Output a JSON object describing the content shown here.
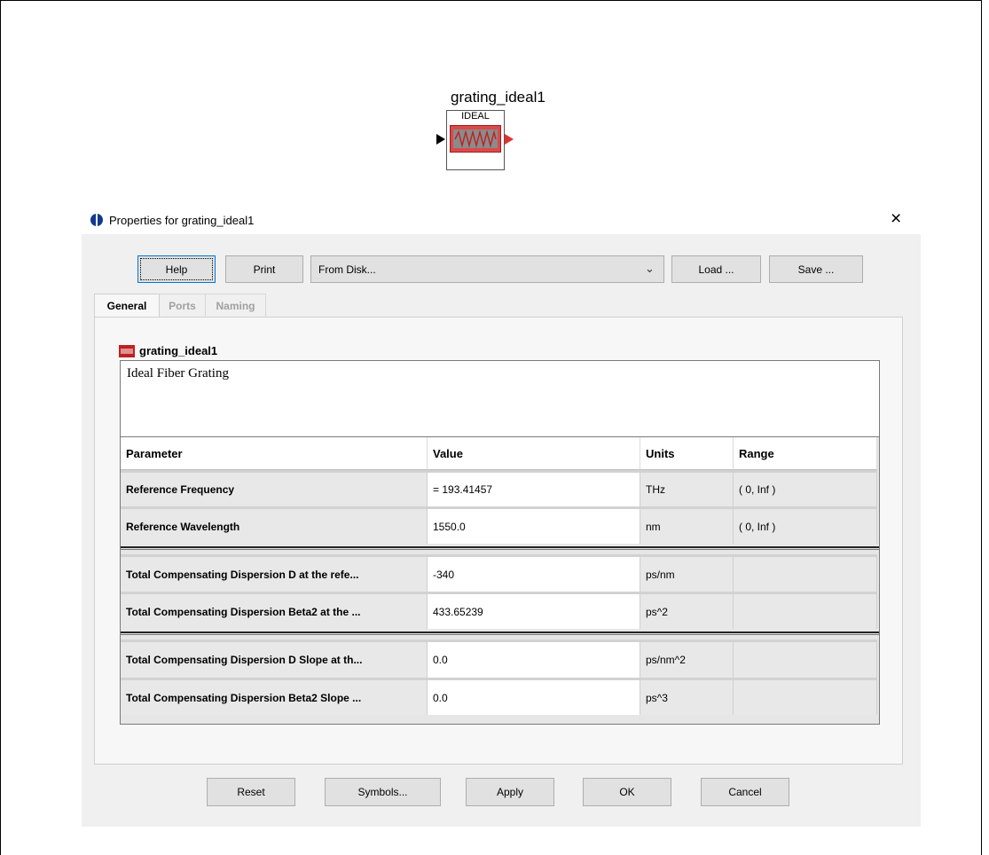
{
  "component": {
    "name": "grating_ideal1",
    "label": "IDEAL",
    "icon": "fiber-grating-icon"
  },
  "dialog": {
    "title": "Properties for grating_ideal1",
    "close_symbol": "×",
    "toolbar": {
      "help": "Help",
      "print": "Print",
      "source_selected": "From Disk...",
      "dropdown_arrow": "⌄",
      "load": "Load ...",
      "save": "Save ..."
    },
    "tabs": [
      {
        "label": "General",
        "active": true
      },
      {
        "label": "Ports",
        "active": false
      },
      {
        "label": "Naming",
        "active": false
      }
    ],
    "panel": {
      "component_name": "grating_ideal1",
      "description": "Ideal Fiber Grating"
    },
    "table": {
      "headers": [
        "Parameter",
        "Value",
        "Units",
        "Range"
      ],
      "rows": [
        [
          "Reference Frequency",
          "= 193.41457",
          "THz",
          "( 0, Inf )"
        ],
        [
          "Reference Wavelength",
          "1550.0",
          "nm",
          "( 0, Inf )"
        ],
        [
          "Total Compensating Dispersion D at the refe...",
          "-340",
          "ps/nm",
          ""
        ],
        [
          "Total Compensating Dispersion Beta2 at the ...",
          "433.65239",
          "ps^2",
          ""
        ],
        [
          "Total Compensating Dispersion D Slope at th...",
          "0.0",
          "ps/nm^2",
          ""
        ],
        [
          "Total Compensating Dispersion Beta2 Slope ...",
          "0.0",
          "ps^3",
          ""
        ]
      ]
    },
    "buttons": {
      "reset": "Reset",
      "symbols": "Symbols...",
      "apply": "Apply",
      "ok": "OK",
      "cancel": "Cancel"
    }
  }
}
